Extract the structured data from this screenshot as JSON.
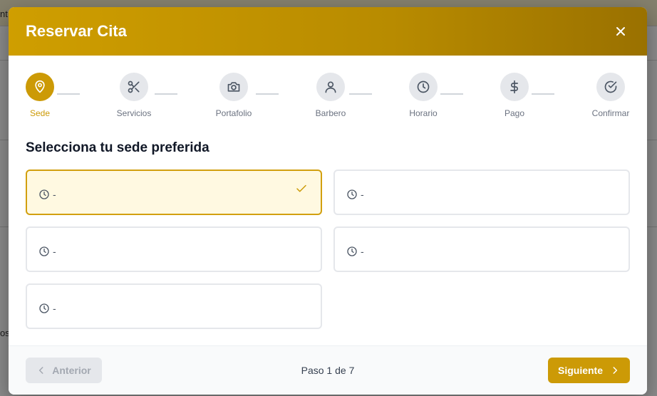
{
  "modal": {
    "title": "Reservar Cita",
    "section_title": "Selecciona tu sede preferida"
  },
  "steps": [
    {
      "label": "Sede",
      "icon": "map-pin-icon",
      "active": true
    },
    {
      "label": "Servicios",
      "icon": "scissors-icon",
      "active": false
    },
    {
      "label": "Portafolio",
      "icon": "camera-icon",
      "active": false
    },
    {
      "label": "Barbero",
      "icon": "user-icon",
      "active": false
    },
    {
      "label": "Horario",
      "icon": "clock-icon",
      "active": false
    },
    {
      "label": "Pago",
      "icon": "dollar-icon",
      "active": false
    },
    {
      "label": "Confirmar",
      "icon": "check-circle-icon",
      "active": false
    }
  ],
  "locations": [
    {
      "hours": "-",
      "selected": true
    },
    {
      "hours": "-",
      "selected": false
    },
    {
      "hours": "-",
      "selected": false
    },
    {
      "hours": "-",
      "selected": false
    },
    {
      "hours": "-",
      "selected": false
    }
  ],
  "footer": {
    "prev_label": "Anterior",
    "next_label": "Siguiente",
    "step_counter": "Paso 1 de 7"
  },
  "background": {
    "fragment_top": "nt",
    "fragment_bottom": "os"
  },
  "colors": {
    "accent": "#cc9a06",
    "selected_bg": "#fff9e1",
    "header_gradient_start": "#cf9e00",
    "header_gradient_end": "#9a7100"
  }
}
